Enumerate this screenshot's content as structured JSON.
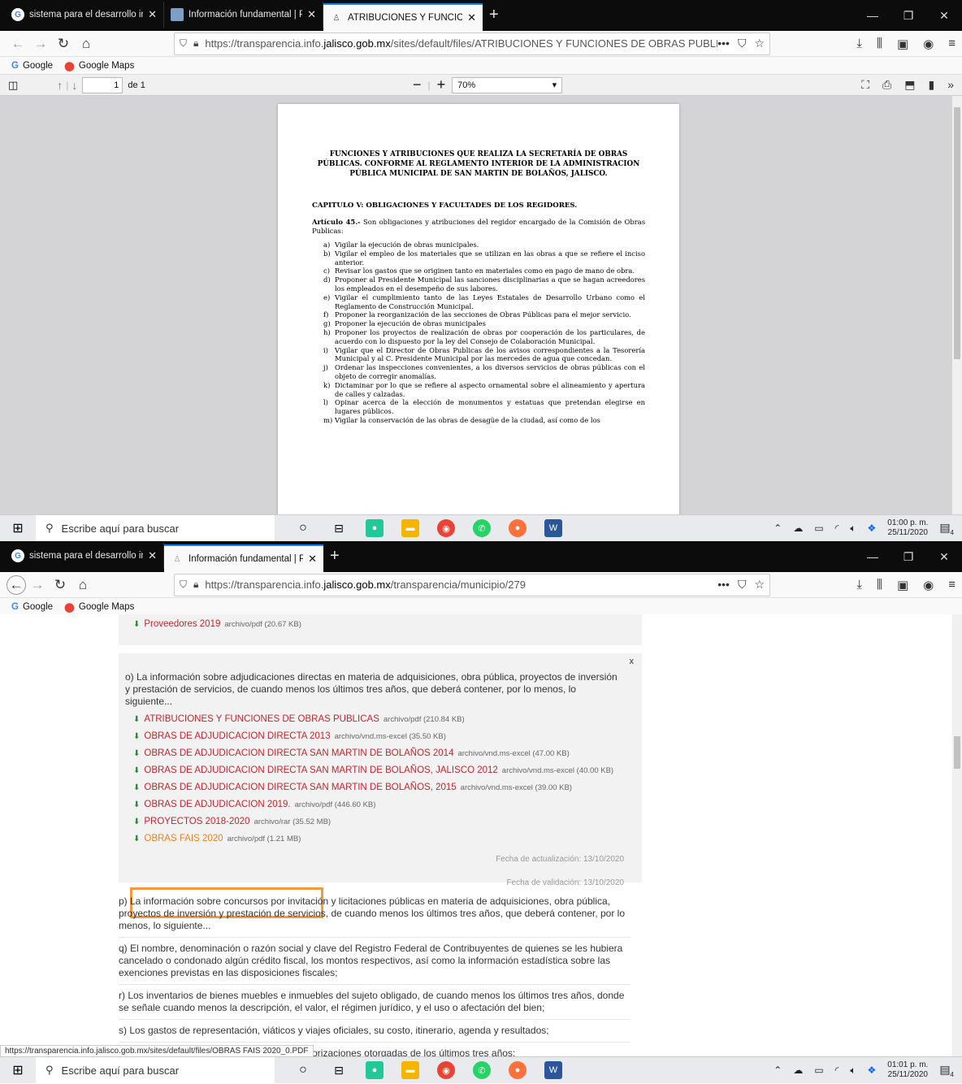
{
  "window1": {
    "tabs": [
      {
        "title": "sistema para el desarrollo integ",
        "icon": "G"
      },
      {
        "title": "Información fundamental | Por",
        "icon": "doc"
      },
      {
        "title": "ATRIBUCIONES Y FUNCIONES D",
        "icon": "seal"
      }
    ],
    "url_prefix": "https://transparencia.info.",
    "url_domain": "jalisco.gob.mx",
    "url_path": "/sites/default/files/ATRIBUCIONES Y FUNCIONES DE OBRAS PUBLICAS.pdf",
    "page_number": "1",
    "page_of": "de 1",
    "zoom": "70%",
    "pdf": {
      "title": "FUNCIONES Y ATRIBUCIONES QUE REALIZA LA SECRETARÍA DE OBRAS PÚBLICAS. CONFORME AL REGLAMENTO INTERIOR DE LA ADMINISTRACION PÚBLICA MUNICIPAL DE SAN MARTIN DE BOLAÑOS, JALISCO.",
      "chapter": "CAPITULO V: OBLIGACIONES Y FACULTADES DE LOS REGIDORES.",
      "article_label": "Artículo 45.-",
      "article_text": " Son obligaciones y atribuciones del regidor encargado de la Comisión de Obras Publicas:",
      "items": [
        {
          "k": "a)",
          "t": "Vigilar la ejecución de obras municipales."
        },
        {
          "k": "b)",
          "t": "Vigilar el empleo de los materiales que se utilizan en las obras a que se refiere el inciso anterior."
        },
        {
          "k": "c)",
          "t": "Revisar los gastos que se originen tanto en materiales como en pago de mano de obra."
        },
        {
          "k": "d)",
          "t": "Proponer al Presidente Municipal las sanciones disciplinarias a que se hagan acreedores los empleados en el desempeño de sus labores."
        },
        {
          "k": "e)",
          "t": "Vigilar el cumplimiento tanto de las Leyes Estatales de Desarrollo Urbano como el Reglamento de Construcción Municipal."
        },
        {
          "k": "f)",
          "t": "Proponer la reorganización de las secciones de Obras Públicas para el mejor servicio."
        },
        {
          "k": "g)",
          "t": "Proponer la ejecución de obras municipales"
        },
        {
          "k": "h)",
          "t": "Proponer los proyectos de realización de obras por cooperación de los particulares, de acuerdo con lo dispuesto por la ley del Consejo de Colaboración Municipal."
        },
        {
          "k": "i)",
          "t": "Vigilar que el Director de Obras Publicas de los avisos correspondientes a la Tesorería Municipal y al C. Presidente Municipal por las mercedes de agua que concedan."
        },
        {
          "k": "j)",
          "t": "Ordenar las inspecciones convenientes, a los diversos servicios de obras públicas con el objeto de corregir anomalías."
        },
        {
          "k": "k)",
          "t": "Dictaminar por lo que se refiere al aspecto ornamental sobre el alineamiento y apertura de calles y calzadas."
        },
        {
          "k": "l)",
          "t": "Opinar acerca de la elección de monumentos y estatuas que pretendan elegirse en lugares públicos."
        },
        {
          "k": "m)",
          "t": "Vigilar la conservación de las obras de desagüe de la ciudad, así como de los"
        }
      ]
    },
    "clock_time": "01:00 p. m.",
    "clock_date": "25/11/2020"
  },
  "window2": {
    "tabs": [
      {
        "title": "sistema para el desarrollo integ",
        "icon": "G"
      },
      {
        "title": "Información fundamental | Por",
        "icon": "doc"
      }
    ],
    "url_prefix": "https://transparencia.info.",
    "url_domain": "jalisco.gob.mx",
    "url_path": "/transparencia/municipio/279",
    "top_item": {
      "name": "Proveedores 2019",
      "meta": "archivo/pdf (20.67 KB)"
    },
    "section_o": "o) La información sobre adjudicaciones directas en materia de adquisiciones, obra pública, proyectos de inversión y prestación de servicios, de cuando menos los últimos tres años, que deberá contener, por lo menos, lo siguiente...",
    "close_x": "x",
    "files": [
      {
        "name": "ATRIBUCIONES Y FUNCIONES DE OBRAS PUBLICAS",
        "meta": "archivo/pdf (210.84 KB)"
      },
      {
        "name": "OBRAS DE ADJUDICACION DIRECTA 2013",
        "meta": "archivo/vnd.ms-excel (35.50 KB)"
      },
      {
        "name": "OBRAS DE ADJUDICACION DIRECTA SAN MARTIN DE BOLAÑOS 2014",
        "meta": "archivo/vnd.ms-excel (47.00 KB)"
      },
      {
        "name": "OBRAS DE ADJUDICACION DIRECTA SAN MARTIN DE BOLAÑOS, JALISCO 2012",
        "meta": "archivo/vnd.ms-excel (40.00 KB)"
      },
      {
        "name": "OBRAS DE ADJUDICACION DIRECTA SAN MARTIN DE BOLAÑOS, 2015",
        "meta": "archivo/vnd.ms-excel (39.00 KB)"
      },
      {
        "name": "OBRAS DE ADJUDICACION 2019.",
        "meta": "archivo/pdf (446.60 KB)"
      },
      {
        "name": "PROYECTOS 2018-2020",
        "meta": "archivo/rar (35.52 MB)"
      },
      {
        "name": "OBRAS FAIS 2020",
        "meta": "archivo/pdf (1.21 MB)"
      }
    ],
    "fecha_actualizacion": "Fecha de actualización: 13/10/2020",
    "fecha_validacion": "Fecha de validación: 13/10/2020",
    "sections": [
      "p) La información sobre concursos por invitación y licitaciones públicas en materia de adquisiciones, obra pública, proyectos de inversión y prestación de servicios, de cuando menos los últimos tres años, que deberá contener, por lo menos, lo siguiente...",
      "q) El nombre, denominación o razón social y clave del Registro Federal de Contribuyentes de quienes se les hubiera cancelado o condonado algún crédito fiscal, los montos respectivos, así como la información estadística sobre las exenciones previstas en las disposiciones fiscales;",
      "r) Los inventarios de bienes muebles e inmuebles del sujeto obligado, de cuando menos los últimos tres años, donde se señale cuando menos la descripción, el valor, el régimen jurídico, y el uso o afectación del bien;",
      "s) Los gastos de representación, viáticos y viajes oficiales, su costo, itinerario, agenda y resultados;",
      "t) Las concesiones, licencias, permisos o autorizaciones otorgadas de los últimos tres años;"
    ],
    "status_url": "https://transparencia.info.jalisco.gob.mx/sites/default/files/OBRAS FAIS 2020_0.PDF",
    "clock_time": "01:01 p. m.",
    "clock_date": "25/11/2020"
  },
  "bookmarks": [
    "Google",
    "Google Maps"
  ],
  "search_placeholder": "Escribe aquí para buscar",
  "notif_count": "4"
}
